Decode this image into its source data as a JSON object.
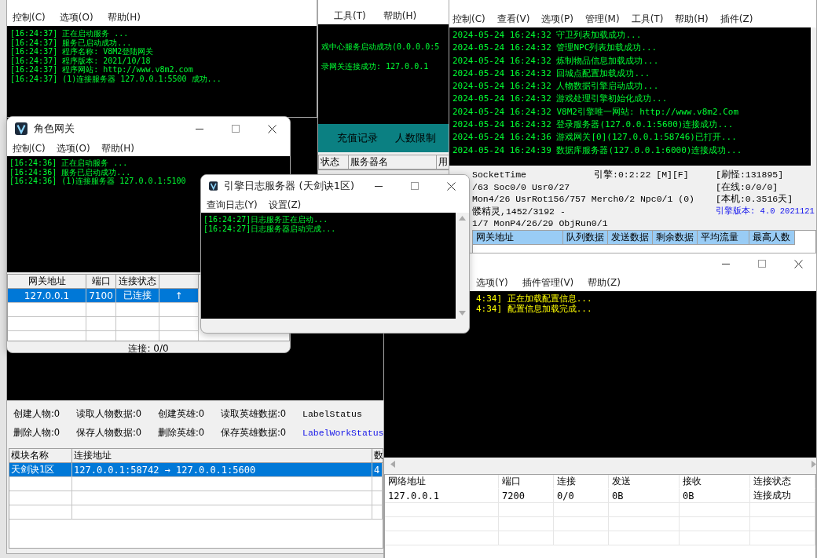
{
  "db_server": {
    "stats": [
      [
        "创建人物:0",
        "读取人物数据:0",
        "创建英雄:0",
        "读取英雄数据:0"
      ],
      [
        "删除人物:0",
        "保存人物数据:0",
        "删除英雄:0",
        "保存英雄数据:0"
      ]
    ],
    "labels": [
      {
        "text": "LabelStatus",
        "kind": "status"
      },
      {
        "text": "LabelWorkStatus",
        "kind": "work"
      }
    ],
    "columns": [
      "模块名称",
      "连接地址",
      "数"
    ],
    "rows": [
      {
        "cells": [
          "天剑诀1区",
          "127.0.0.1:58742 → 127.0.0.1:5600",
          "4"
        ],
        "selected": true
      }
    ]
  },
  "login_gate": {
    "menu": [
      "控制(C)",
      "选项(O)",
      "帮助(H)"
    ],
    "log": [
      "[16:24:37] 正在启动服务 ...",
      "[16:24:37] 服务已启动成功...",
      "[16:24:37] 程序名称: V8M2登陆网关",
      "[16:24:37] 程序版本: 2021/10/18",
      "[16:24:37] 程序网站: http://www.v8m2.com",
      "[16:24:37] (1)连接服务器 127.0.0.1:5500 成功..."
    ]
  },
  "login_server": {
    "menu": [
      "工具(T)",
      "帮助(H)"
    ],
    "log": [
      "戏中心服务启动成功(0.0.0.0:5",
      "录网关连接成功: 127.0.0.1"
    ],
    "tabs": [
      "充值记录",
      "人数限制"
    ],
    "columns": [
      "状态",
      "服务器名",
      "用"
    ]
  },
  "m2_server": {
    "menu": [
      "控制(C)",
      "查看(V)",
      "选项(P)",
      "管理(M)",
      "工具(T)",
      "帮助(H)",
      "插件(Z)"
    ],
    "log": [
      "2024-05-24 16:24:32 守卫列表加载成功...",
      "2024-05-24 16:24:32 管理NPC列表加载成功...",
      "2024-05-24 16:24:32 炼制物品信息加载成功...",
      "2024-05-24 16:24:32 回城点配置加载成功...",
      "2024-05-24 16:24:32 人物数据引擎启动成功...",
      "2024-05-24 16:24:32 游戏处理引擎初始化成功...",
      "2024-05-24 16:24:32 V8M2引擎唯一网站: http://www.v8m2.Com",
      "2024-05-24 16:24:32 登录服务器(127.0.0.1:5600)连接成功...",
      "2024-05-24 16:24:36 游戏网关[0](127.0.0.1:58746)已打开...",
      "2024-05-24 16:24:39 数据库服务器(127.0.0.1:6000)连接成功..."
    ],
    "status_lines": [
      "SocketTime",
      "/63 Soc0/0 Usr0/27",
      "Mon4/26 UsrRot156/757 Merch0/2 Npc0/1 (0)",
      "髅精灵,1452/3192 -",
      "1/7 MonP4/26/29 ObjRun0/1"
    ],
    "engine": "引擎:0:2:22 [M][F]",
    "stats": [
      "[刷怪:131895]",
      "[在线:0/0/0]",
      "[本机:0.3516天]"
    ],
    "version": "引擎版本: 4.0 2021121",
    "columns": [
      "网关地址",
      "队列数据",
      "发送数据",
      "剩余数据",
      "平均流量",
      "最高人数"
    ]
  },
  "game_gate": {
    "menu": [
      "选项(Y)",
      "插件管理(V)",
      "帮助(Z)"
    ],
    "log": [
      "4:34] 正在加载配置信息...",
      "4:34] 配置信息加载完成..."
    ],
    "columns": [
      "网络地址",
      "端口",
      "连接",
      "发送",
      "接收",
      "连接状态"
    ],
    "rows": [
      {
        "cells": [
          "127.0.0.1",
          "7200",
          "0/0",
          "0B",
          "0B",
          "连接成功"
        ]
      }
    ]
  },
  "role_gate": {
    "title": "角色网关",
    "menu": [
      "控制(C)",
      "选项(O)",
      "帮助(H)"
    ],
    "log": [
      "[16:24:36] 正在启动服务 ...",
      "[16:24:36] 服务已启动成功...",
      "[16:24:36] (1)连接服务器 127.0.0.1:5100"
    ],
    "columns": [
      "网关地址",
      "端口",
      "连接状态"
    ],
    "rows": [
      {
        "cells": [
          "127.0.0.1",
          "7100",
          "已连接",
          "↑"
        ],
        "selected": true
      }
    ],
    "status": "连接: 0/0"
  },
  "log_server": {
    "title": "引擎日志服务器 (天剑诀1区)",
    "menu": [
      "查询日志(Y)",
      "设置(Z)"
    ],
    "log": [
      "[16:24:27]日志服务正在启动...",
      "[16:24:27]日志服务器启动完成..."
    ]
  }
}
